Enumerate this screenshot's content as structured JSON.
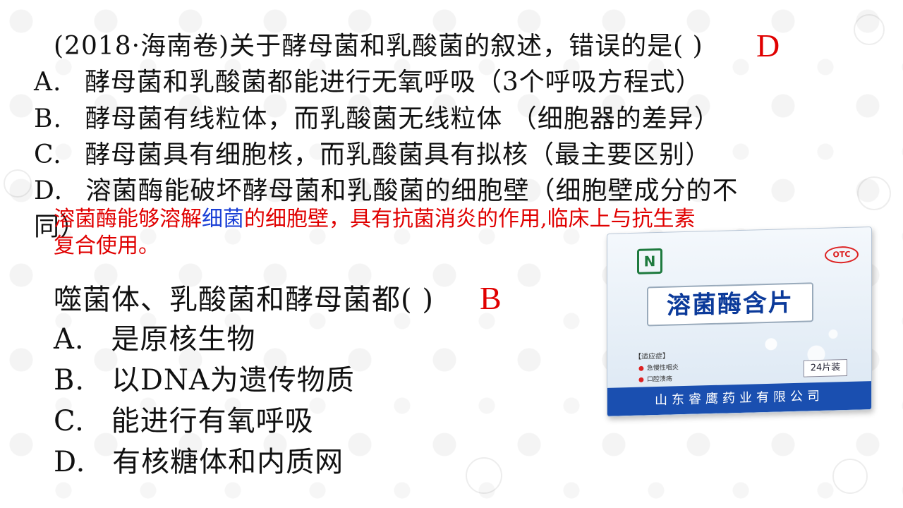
{
  "question1": {
    "stem": "(2018·海南卷)关于酵母菌和乳酸菌的叙述，错误的是(     )",
    "answer": "D",
    "options": [
      {
        "letter": "A.",
        "text": "酵母菌和乳酸菌都能进行无氧呼吸（3个呼吸方程式）"
      },
      {
        "letter": "B.",
        "text": "酵母菌有线粒体，而乳酸菌无线粒体  （细胞器的差异）"
      },
      {
        "letter": "C.",
        "text": "酵母菌具有细胞核，而乳酸菌具有拟核（最主要区别）"
      },
      {
        "letter": "D.",
        "text": "溶菌酶能破坏酵母菌和乳酸菌的细胞壁（细胞壁成分的不"
      }
    ],
    "wrap": "同）"
  },
  "note": {
    "part1": "溶菌酶能够溶解",
    "part2_blue": "细菌",
    "part3": "的细胞壁，具有抗菌消炎的作用,临床上与抗生素",
    "line2": "复合使用。"
  },
  "question2": {
    "stem": "噬菌体、乳酸菌和酵母菌都(     )",
    "answer": "B",
    "options": [
      {
        "letter": "A.",
        "text": "是原核生物"
      },
      {
        "letter": "B.",
        "text": "以DNA为遗传物质"
      },
      {
        "letter": "C.",
        "text": "能进行有氧呼吸"
      },
      {
        "letter": "D.",
        "text": "有核糖体和内质网"
      }
    ]
  },
  "medicine_box": {
    "title": "溶菌酶含片",
    "otc": "OTC",
    "indication": "【适应症】",
    "indication_items": [
      "急慢性咽炎",
      "口腔溃疡"
    ],
    "count": "24片装",
    "manufacturer": "山东睿鹰药业有限公司"
  }
}
